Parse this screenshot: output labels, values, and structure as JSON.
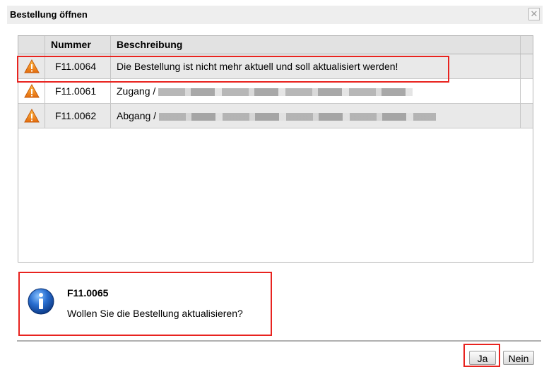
{
  "dialog": {
    "title": "Bestellung öffnen",
    "close_symbol": "✕"
  },
  "grid": {
    "columns": [
      "",
      "Nummer",
      "Beschreibung"
    ],
    "rows": [
      {
        "icon": "warning-icon",
        "number": "F11.0064",
        "description": "Die Bestellung ist nicht mehr aktuell und soll aktualisiert werden!",
        "blurred": false
      },
      {
        "icon": "warning-icon",
        "number": "F11.0061",
        "description": "Zugang /",
        "blurred": true
      },
      {
        "icon": "warning-icon",
        "number": "F11.0062",
        "description": "Abgang /",
        "blurred": true
      }
    ]
  },
  "message": {
    "icon": "info-icon",
    "code": "F11.0065",
    "text": "Wollen Sie die Bestellung aktualisieren?"
  },
  "buttons": {
    "yes": "Ja",
    "no": "Nein"
  },
  "colors": {
    "highlight": "#e8231f",
    "warning": "#f08a1c",
    "info": "#1a5fb4"
  }
}
